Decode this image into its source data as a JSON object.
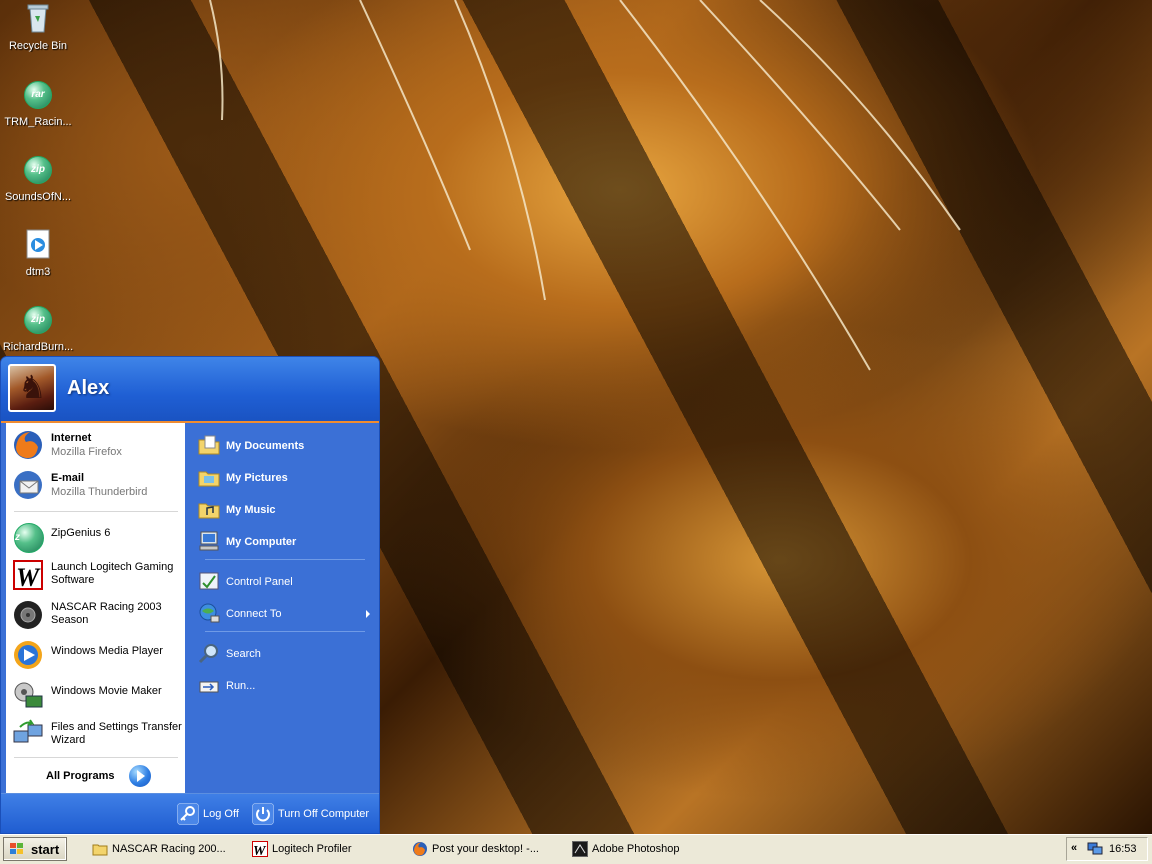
{
  "desktop": {
    "icons": [
      {
        "label": "Recycle Bin",
        "icon": "recycle-bin-icon"
      },
      {
        "label": "TRM_Racin...",
        "icon": "rar-archive-icon"
      },
      {
        "label": "SoundsOfN...",
        "icon": "zip-archive-icon"
      },
      {
        "label": "dtm3",
        "icon": "media-file-icon"
      },
      {
        "label": "RichardBurn...",
        "icon": "zip-archive-icon"
      }
    ]
  },
  "start_menu": {
    "user": "Alex",
    "pinned": [
      {
        "title": "Internet",
        "subtitle": "Mozilla Firefox",
        "icon": "firefox-icon"
      },
      {
        "title": "E-mail",
        "subtitle": "Mozilla Thunderbird",
        "icon": "thunderbird-icon"
      }
    ],
    "recent": [
      {
        "label": "ZipGenius 6",
        "icon": "zipgenius-icon"
      },
      {
        "label": "Launch Logitech Gaming Software",
        "icon": "logitech-w-icon"
      },
      {
        "label": "NASCAR Racing 2003 Season",
        "icon": "tire-icon"
      },
      {
        "label": "Windows Media Player",
        "icon": "media-player-icon"
      },
      {
        "label": "Windows Movie Maker",
        "icon": "movie-maker-icon"
      },
      {
        "label": "Files and Settings Transfer Wizard",
        "icon": "transfer-wizard-icon"
      }
    ],
    "all_programs": "All Programs",
    "places": [
      {
        "label": "My Documents",
        "icon": "my-documents-icon"
      },
      {
        "label": "My Pictures",
        "icon": "my-pictures-icon"
      },
      {
        "label": "My Music",
        "icon": "my-music-icon"
      },
      {
        "label": "My Computer",
        "icon": "my-computer-icon"
      }
    ],
    "system": [
      {
        "label": "Control Panel",
        "icon": "control-panel-icon"
      },
      {
        "label": "Connect To",
        "icon": "connect-to-icon"
      }
    ],
    "tools": [
      {
        "label": "Search",
        "icon": "search-icon"
      },
      {
        "label": "Run...",
        "icon": "run-icon"
      }
    ],
    "log_off": "Log Off",
    "turn_off": "Turn Off Computer"
  },
  "taskbar": {
    "start_label": "start",
    "tasks": [
      {
        "label": "NASCAR Racing 200...",
        "icon": "folder-icon"
      },
      {
        "label": "Logitech Profiler",
        "icon": "logitech-w-icon"
      },
      {
        "label": "Post your desktop! -...",
        "icon": "firefox-icon"
      },
      {
        "label": "Adobe Photoshop",
        "icon": "photoshop-icon"
      }
    ],
    "tray_chevron": "«",
    "clock": "16:53"
  },
  "colors": {
    "start_menu_blue": "#3b70d6",
    "separator_orange": "#f08c30",
    "taskbar": "#ece9d8"
  }
}
